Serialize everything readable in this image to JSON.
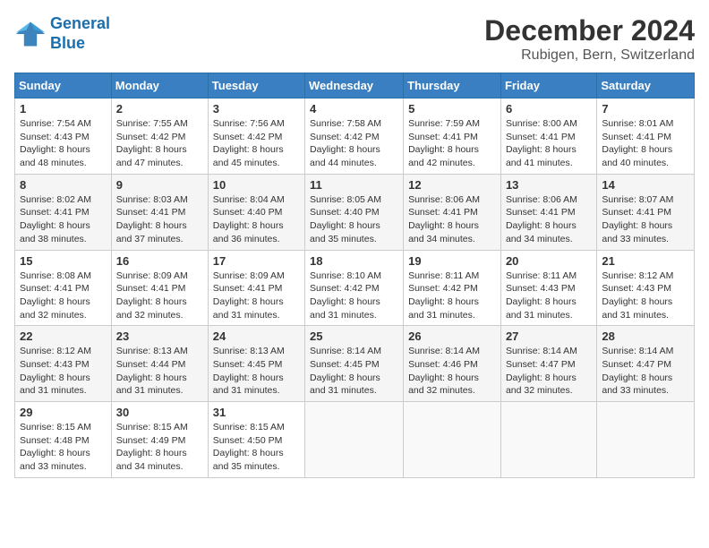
{
  "header": {
    "logo_line1": "General",
    "logo_line2": "Blue",
    "title": "December 2024",
    "subtitle": "Rubigen, Bern, Switzerland"
  },
  "weekdays": [
    "Sunday",
    "Monday",
    "Tuesday",
    "Wednesday",
    "Thursday",
    "Friday",
    "Saturday"
  ],
  "weeks": [
    [
      {
        "day": "1",
        "sunrise": "7:54 AM",
        "sunset": "4:43 PM",
        "daylight": "8 hours and 48 minutes."
      },
      {
        "day": "2",
        "sunrise": "7:55 AM",
        "sunset": "4:42 PM",
        "daylight": "8 hours and 47 minutes."
      },
      {
        "day": "3",
        "sunrise": "7:56 AM",
        "sunset": "4:42 PM",
        "daylight": "8 hours and 45 minutes."
      },
      {
        "day": "4",
        "sunrise": "7:58 AM",
        "sunset": "4:42 PM",
        "daylight": "8 hours and 44 minutes."
      },
      {
        "day": "5",
        "sunrise": "7:59 AM",
        "sunset": "4:41 PM",
        "daylight": "8 hours and 42 minutes."
      },
      {
        "day": "6",
        "sunrise": "8:00 AM",
        "sunset": "4:41 PM",
        "daylight": "8 hours and 41 minutes."
      },
      {
        "day": "7",
        "sunrise": "8:01 AM",
        "sunset": "4:41 PM",
        "daylight": "8 hours and 40 minutes."
      }
    ],
    [
      {
        "day": "8",
        "sunrise": "8:02 AM",
        "sunset": "4:41 PM",
        "daylight": "8 hours and 38 minutes."
      },
      {
        "day": "9",
        "sunrise": "8:03 AM",
        "sunset": "4:41 PM",
        "daylight": "8 hours and 37 minutes."
      },
      {
        "day": "10",
        "sunrise": "8:04 AM",
        "sunset": "4:40 PM",
        "daylight": "8 hours and 36 minutes."
      },
      {
        "day": "11",
        "sunrise": "8:05 AM",
        "sunset": "4:40 PM",
        "daylight": "8 hours and 35 minutes."
      },
      {
        "day": "12",
        "sunrise": "8:06 AM",
        "sunset": "4:41 PM",
        "daylight": "8 hours and 34 minutes."
      },
      {
        "day": "13",
        "sunrise": "8:06 AM",
        "sunset": "4:41 PM",
        "daylight": "8 hours and 34 minutes."
      },
      {
        "day": "14",
        "sunrise": "8:07 AM",
        "sunset": "4:41 PM",
        "daylight": "8 hours and 33 minutes."
      }
    ],
    [
      {
        "day": "15",
        "sunrise": "8:08 AM",
        "sunset": "4:41 PM",
        "daylight": "8 hours and 32 minutes."
      },
      {
        "day": "16",
        "sunrise": "8:09 AM",
        "sunset": "4:41 PM",
        "daylight": "8 hours and 32 minutes."
      },
      {
        "day": "17",
        "sunrise": "8:09 AM",
        "sunset": "4:41 PM",
        "daylight": "8 hours and 31 minutes."
      },
      {
        "day": "18",
        "sunrise": "8:10 AM",
        "sunset": "4:42 PM",
        "daylight": "8 hours and 31 minutes."
      },
      {
        "day": "19",
        "sunrise": "8:11 AM",
        "sunset": "4:42 PM",
        "daylight": "8 hours and 31 minutes."
      },
      {
        "day": "20",
        "sunrise": "8:11 AM",
        "sunset": "4:43 PM",
        "daylight": "8 hours and 31 minutes."
      },
      {
        "day": "21",
        "sunrise": "8:12 AM",
        "sunset": "4:43 PM",
        "daylight": "8 hours and 31 minutes."
      }
    ],
    [
      {
        "day": "22",
        "sunrise": "8:12 AM",
        "sunset": "4:43 PM",
        "daylight": "8 hours and 31 minutes."
      },
      {
        "day": "23",
        "sunrise": "8:13 AM",
        "sunset": "4:44 PM",
        "daylight": "8 hours and 31 minutes."
      },
      {
        "day": "24",
        "sunrise": "8:13 AM",
        "sunset": "4:45 PM",
        "daylight": "8 hours and 31 minutes."
      },
      {
        "day": "25",
        "sunrise": "8:14 AM",
        "sunset": "4:45 PM",
        "daylight": "8 hours and 31 minutes."
      },
      {
        "day": "26",
        "sunrise": "8:14 AM",
        "sunset": "4:46 PM",
        "daylight": "8 hours and 32 minutes."
      },
      {
        "day": "27",
        "sunrise": "8:14 AM",
        "sunset": "4:47 PM",
        "daylight": "8 hours and 32 minutes."
      },
      {
        "day": "28",
        "sunrise": "8:14 AM",
        "sunset": "4:47 PM",
        "daylight": "8 hours and 33 minutes."
      }
    ],
    [
      {
        "day": "29",
        "sunrise": "8:15 AM",
        "sunset": "4:48 PM",
        "daylight": "8 hours and 33 minutes."
      },
      {
        "day": "30",
        "sunrise": "8:15 AM",
        "sunset": "4:49 PM",
        "daylight": "8 hours and 34 minutes."
      },
      {
        "day": "31",
        "sunrise": "8:15 AM",
        "sunset": "4:50 PM",
        "daylight": "8 hours and 35 minutes."
      },
      null,
      null,
      null,
      null
    ]
  ]
}
